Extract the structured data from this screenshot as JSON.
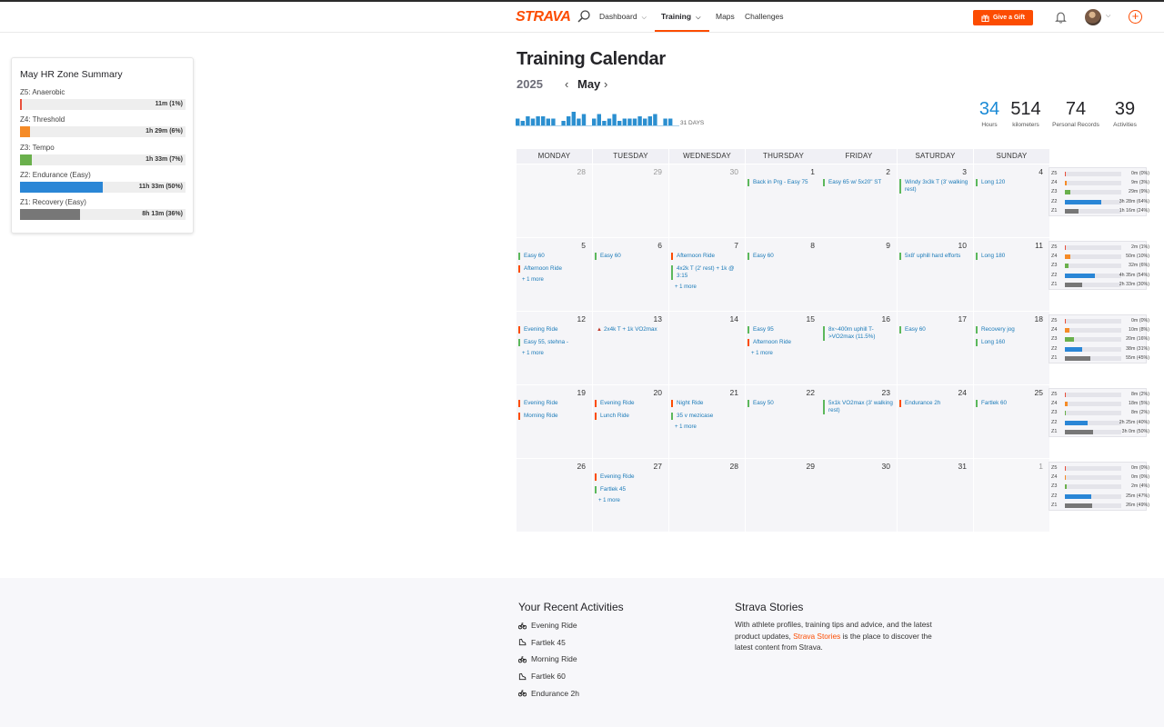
{
  "nav": {
    "logo": "STRAVA",
    "dashboard": "Dashboard",
    "training": "Training",
    "maps": "Maps",
    "challenges": "Challenges",
    "gift": "Give a Gift"
  },
  "hr_summary": {
    "title": "May HR Zone Summary",
    "zones": [
      {
        "label": "Z5: Anaerobic",
        "value": "11m (1%)",
        "pct": 1,
        "color": "#e8503c"
      },
      {
        "label": "Z4: Threshold",
        "value": "1h 29m (6%)",
        "pct": 6,
        "color": "#f58b27"
      },
      {
        "label": "Z3: Tempo",
        "value": "1h 33m (7%)",
        "pct": 7,
        "color": "#6ab04c"
      },
      {
        "label": "Z2: Endurance (Easy)",
        "value": "11h 33m (50%)",
        "pct": 50,
        "color": "#2a86d6"
      },
      {
        "label": "Z1: Recovery (Easy)",
        "value": "8h 13m (36%)",
        "pct": 36,
        "color": "#777777"
      }
    ]
  },
  "header": {
    "title": "Training Calendar",
    "year": "2025",
    "month": "May",
    "days": "31 DAYS"
  },
  "daily_volume": [
    3,
    2,
    4,
    3,
    4,
    4,
    3,
    3,
    0,
    2,
    4,
    6,
    3,
    5,
    0,
    3,
    5,
    2,
    3,
    5,
    2,
    3,
    3,
    3,
    4,
    3,
    4,
    5,
    0,
    3,
    3
  ],
  "stats": [
    {
      "value": "34",
      "label": "Hours"
    },
    {
      "value": "514",
      "label": "kilometers"
    },
    {
      "value": "74",
      "label": "Personal Records"
    },
    {
      "value": "39",
      "label": "Activities"
    }
  ],
  "weekdays": [
    "MONDAY",
    "TUESDAY",
    "WEDNESDAY",
    "THURSDAY",
    "FRIDAY",
    "SATURDAY",
    "SUNDAY"
  ],
  "weeks": [
    {
      "days": [
        {
          "num": "28",
          "other": true,
          "acts": []
        },
        {
          "num": "29",
          "other": true,
          "acts": []
        },
        {
          "num": "30",
          "other": true,
          "acts": []
        },
        {
          "num": "1",
          "acts": [
            {
              "t": "Back in Prg - Easy 75",
              "k": "run"
            }
          ]
        },
        {
          "num": "2",
          "acts": [
            {
              "t": "Easy 65 w/ 5x20\" ST",
              "k": "run"
            }
          ]
        },
        {
          "num": "3",
          "acts": [
            {
              "t": "Windy 3x3k T (3' walking rest)",
              "k": "run"
            }
          ]
        },
        {
          "num": "4",
          "acts": [
            {
              "t": "Long 120",
              "k": "run"
            }
          ]
        }
      ],
      "zones": [
        {
          "z": "Z5",
          "v": "0m (0%)",
          "p": 0
        },
        {
          "z": "Z4",
          "v": "9m (3%)",
          "p": 3
        },
        {
          "z": "Z3",
          "v": "29m (9%)",
          "p": 9
        },
        {
          "z": "Z2",
          "v": "3h 28m (64%)",
          "p": 64
        },
        {
          "z": "Z1",
          "v": "1h 16m (24%)",
          "p": 24
        }
      ]
    },
    {
      "days": [
        {
          "num": "5",
          "acts": [
            {
              "t": "Easy 60",
              "k": "run"
            },
            {
              "t": "Afternoon Ride",
              "k": "ride"
            }
          ],
          "more": "+ 1 more"
        },
        {
          "num": "6",
          "acts": [
            {
              "t": "Easy 60",
              "k": "run"
            }
          ]
        },
        {
          "num": "7",
          "acts": [
            {
              "t": "Afternoon Ride",
              "k": "ride"
            },
            {
              "t": "4x2k T (2' rest) + 1k @ 3:15",
              "k": "run"
            }
          ],
          "more": "+ 1 more"
        },
        {
          "num": "8",
          "acts": [
            {
              "t": "Easy 60",
              "k": "run"
            }
          ]
        },
        {
          "num": "9",
          "acts": []
        },
        {
          "num": "10",
          "acts": [
            {
              "t": "5x8' uphill hard efforts",
              "k": "run"
            }
          ]
        },
        {
          "num": "11",
          "acts": [
            {
              "t": "Long 180",
              "k": "run"
            }
          ]
        }
      ],
      "zones": [
        {
          "z": "Z5",
          "v": "2m (1%)",
          "p": 1
        },
        {
          "z": "Z4",
          "v": "50m (10%)",
          "p": 10
        },
        {
          "z": "Z3",
          "v": "32m (6%)",
          "p": 6
        },
        {
          "z": "Z2",
          "v": "4h 35m (54%)",
          "p": 54
        },
        {
          "z": "Z1",
          "v": "2h 33m (30%)",
          "p": 30
        }
      ]
    },
    {
      "days": [
        {
          "num": "12",
          "acts": [
            {
              "t": "Evening Ride",
              "k": "ride"
            },
            {
              "t": "Easy 55, stehna -",
              "k": "run"
            }
          ],
          "more": "+ 1 more"
        },
        {
          "num": "13",
          "acts": [
            {
              "t": "2x4k T + 1k VO2max",
              "k": "flame"
            }
          ]
        },
        {
          "num": "14",
          "acts": []
        },
        {
          "num": "15",
          "acts": [
            {
              "t": "Easy 95",
              "k": "run"
            },
            {
              "t": "Afternoon Ride",
              "k": "ride"
            }
          ],
          "more": "+ 1 more"
        },
        {
          "num": "16",
          "acts": [
            {
              "t": "8x~400m uphill T->VO2max (11.5%)",
              "k": "run"
            }
          ]
        },
        {
          "num": "17",
          "acts": [
            {
              "t": "Easy 60",
              "k": "run"
            }
          ]
        },
        {
          "num": "18",
          "acts": [
            {
              "t": "Recovery jog",
              "k": "run"
            },
            {
              "t": "Long 160",
              "k": "run"
            }
          ]
        }
      ],
      "zones": [
        {
          "z": "Z5",
          "v": "0m (0%)",
          "p": 0
        },
        {
          "z": "Z4",
          "v": "10m (8%)",
          "p": 8
        },
        {
          "z": "Z3",
          "v": "20m (16%)",
          "p": 16
        },
        {
          "z": "Z2",
          "v": "38m (31%)",
          "p": 31
        },
        {
          "z": "Z1",
          "v": "55m (45%)",
          "p": 45
        }
      ]
    },
    {
      "days": [
        {
          "num": "19",
          "acts": [
            {
              "t": "Evening Ride",
              "k": "ride"
            },
            {
              "t": "Morning Ride",
              "k": "ride"
            }
          ]
        },
        {
          "num": "20",
          "acts": [
            {
              "t": "Evening Ride",
              "k": "ride"
            },
            {
              "t": "Lunch Ride",
              "k": "ride"
            }
          ]
        },
        {
          "num": "21",
          "acts": [
            {
              "t": "Night Ride",
              "k": "ride"
            },
            {
              "t": "35 v mezicase",
              "k": "run"
            }
          ],
          "more": "+ 1 more"
        },
        {
          "num": "22",
          "acts": [
            {
              "t": "Easy 50",
              "k": "run"
            }
          ]
        },
        {
          "num": "23",
          "acts": [
            {
              "t": "5x1k VO2max (3' walking rest)",
              "k": "run"
            }
          ]
        },
        {
          "num": "24",
          "acts": [
            {
              "t": "Endurance 2h",
              "k": "ride"
            }
          ]
        },
        {
          "num": "25",
          "acts": [
            {
              "t": "Fartlek 60",
              "k": "run"
            }
          ]
        }
      ],
      "zones": [
        {
          "z": "Z5",
          "v": "8m (2%)",
          "p": 2
        },
        {
          "z": "Z4",
          "v": "18m (5%)",
          "p": 5
        },
        {
          "z": "Z3",
          "v": "8m (2%)",
          "p": 2
        },
        {
          "z": "Z2",
          "v": "2h 25m (40%)",
          "p": 40
        },
        {
          "z": "Z1",
          "v": "3h 0m (50%)",
          "p": 50
        }
      ]
    },
    {
      "days": [
        {
          "num": "26",
          "acts": []
        },
        {
          "num": "27",
          "acts": [
            {
              "t": "Evening Ride",
              "k": "ride"
            },
            {
              "t": "Fartlek 45",
              "k": "run"
            }
          ],
          "more": "+ 1 more"
        },
        {
          "num": "28",
          "acts": []
        },
        {
          "num": "29",
          "acts": []
        },
        {
          "num": "30",
          "acts": []
        },
        {
          "num": "31",
          "acts": []
        },
        {
          "num": "1",
          "other": true,
          "acts": []
        }
      ],
      "zones": [
        {
          "z": "Z5",
          "v": "0m (0%)",
          "p": 0
        },
        {
          "z": "Z4",
          "v": "0m (0%)",
          "p": 0
        },
        {
          "z": "Z3",
          "v": "2m (4%)",
          "p": 4
        },
        {
          "z": "Z2",
          "v": "25m (47%)",
          "p": 47
        },
        {
          "z": "Z1",
          "v": "26m (49%)",
          "p": 49
        }
      ]
    }
  ],
  "zone_colors": {
    "Z5": "#e8503c",
    "Z4": "#f58b27",
    "Z3": "#6ab04c",
    "Z2": "#2a86d6",
    "Z1": "#777777"
  },
  "recent": {
    "title": "Your Recent Activities",
    "items": [
      {
        "label": "Evening Ride",
        "icon": "bike-icon"
      },
      {
        "label": "Fartlek 45",
        "icon": "shoe-icon"
      },
      {
        "label": "Morning Ride",
        "icon": "bike-icon"
      },
      {
        "label": "Fartlek 60",
        "icon": "shoe-icon"
      },
      {
        "label": "Endurance 2h",
        "icon": "bike-icon"
      }
    ]
  },
  "stories": {
    "title": "Strava Stories",
    "text_before": "With athlete profiles, training tips and advice, and the latest product updates, ",
    "link": "Strava Stories",
    "text_after": " is the place to discover the latest content from Strava."
  }
}
